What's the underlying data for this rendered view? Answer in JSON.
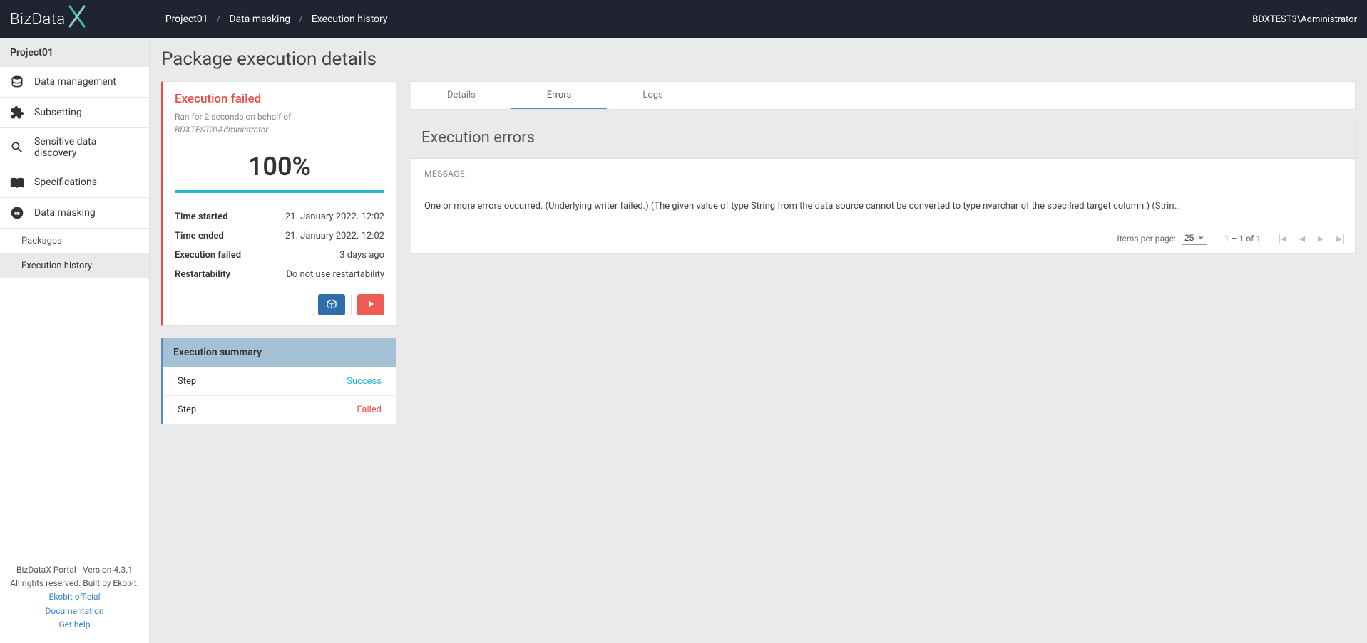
{
  "logo": "BizData",
  "breadcrumb": [
    "Project01",
    "Data masking",
    "Execution history"
  ],
  "user": "BDXTEST3\\Administrator",
  "sidebar": {
    "project": "Project01",
    "items": [
      {
        "label": "Data management"
      },
      {
        "label": "Subsetting"
      },
      {
        "label": "Sensitive data discovery"
      },
      {
        "label": "Specifications"
      },
      {
        "label": "Data masking"
      }
    ],
    "sub": [
      {
        "label": "Packages",
        "active": false
      },
      {
        "label": "Execution history",
        "active": true
      }
    ],
    "footer": {
      "version": "BizDataX Portal - Version 4.3.1",
      "rights": "All rights reserved. Built by Ekobit.",
      "links": [
        "Ekobit official",
        "Documentation",
        "Get help"
      ]
    }
  },
  "page_title": "Package execution details",
  "exec": {
    "status_title": "Execution failed",
    "status_line1": "Ran for 2 seconds on behalf of",
    "status_user": "BDXTEST3\\Administrator",
    "percent": "100%",
    "details": [
      {
        "label": "Time started",
        "value": "21. January 2022. 12:02"
      },
      {
        "label": "Time ended",
        "value": "21. January 2022. 12:02"
      },
      {
        "label": "Execution failed",
        "value": "3 days ago"
      },
      {
        "label": "Restartability",
        "value": "Do not use restartability"
      }
    ]
  },
  "summary": {
    "header": "Execution summary",
    "rows": [
      {
        "label": "Step",
        "status": "Success",
        "class": "status-success"
      },
      {
        "label": "Step",
        "status": "Failed",
        "class": "status-failed"
      }
    ]
  },
  "tabs": [
    "Details",
    "Errors",
    "Logs"
  ],
  "active_tab": "Errors",
  "errors": {
    "header": "Execution errors",
    "col": "MESSAGE",
    "rows": [
      "One or more errors occurred. (Underlying writer failed.) (The given value of type String from the data source cannot be converted to type nvarchar of the specified target column.) (Strin…"
    ]
  },
  "paginator": {
    "ipp_label": "Items per page:",
    "ipp_value": "25",
    "range": "1 – 1 of 1"
  }
}
